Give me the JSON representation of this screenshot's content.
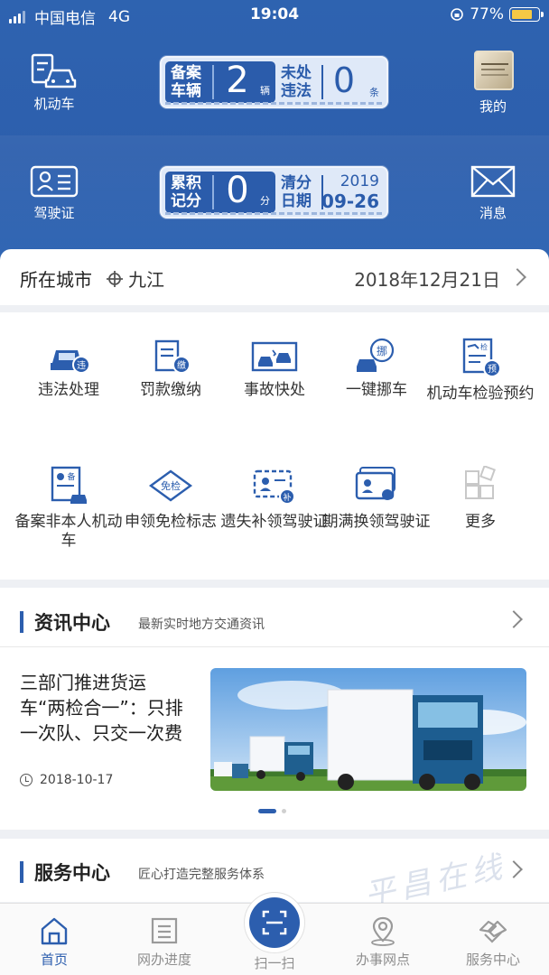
{
  "status_bar": {
    "carrier": "中国电信",
    "network": "4G",
    "time": "19:04",
    "battery": "77%",
    "battery_level": 0.77
  },
  "header": {
    "vehicle_label": "机动车",
    "license_label": "驾驶证",
    "me_label": "我的",
    "message_label": "消息",
    "panel1": {
      "left_label": "备案车辆",
      "left_value": "2",
      "left_unit": "辆",
      "right_label": "未处违法",
      "right_value": "0",
      "right_unit": "条"
    },
    "panel2": {
      "left_label": "累积记分",
      "left_value": "0",
      "left_unit": "分",
      "right_label": "清分日期",
      "year": "2019",
      "month_day": "09-26"
    }
  },
  "city_bar": {
    "label": "所在城市",
    "city": "九江",
    "date": "2018年12月21日"
  },
  "services": [
    {
      "label": "违法处理",
      "icon": "car-violation-icon"
    },
    {
      "label": "罚款缴纳",
      "icon": "fine-payment-icon"
    },
    {
      "label": "事故快处",
      "icon": "accident-icon"
    },
    {
      "label": "一键挪车",
      "icon": "move-car-icon"
    },
    {
      "label": "机动车检验预约",
      "icon": "inspection-booking-icon"
    },
    {
      "label": "备案非本人机动车",
      "icon": "register-vehicle-icon"
    },
    {
      "label": "申领免检标志",
      "icon": "exempt-badge-icon"
    },
    {
      "label": "遗失补领驾驶证",
      "icon": "reissue-license-icon"
    },
    {
      "label": "期满换领驾驶证",
      "icon": "renew-license-icon"
    },
    {
      "label": "更多",
      "icon": "more-grid-icon"
    }
  ],
  "icon_badges": {
    "violation": "违",
    "fine": "缴",
    "move": "挪",
    "inspection_top": "检",
    "inspection": "预",
    "register": "备",
    "exempt": "免检",
    "reissue": "补"
  },
  "news": {
    "section_title": "资讯中心",
    "section_subtitle": "最新实时地方交通资讯",
    "title": "三部门推进货运车“两检合一”：只排一次队、只交一次费",
    "date": "2018-10-17"
  },
  "service_center": {
    "title": "服务中心",
    "subtitle": "匠心打造完整服务体系"
  },
  "tabs": [
    {
      "label": "首页",
      "icon": "home-icon",
      "active": true
    },
    {
      "label": "网办进度",
      "icon": "progress-icon",
      "active": false
    },
    {
      "label": "扫一扫",
      "icon": "scan-icon",
      "active": false
    },
    {
      "label": "办事网点",
      "icon": "location-icon",
      "active": false
    },
    {
      "label": "服务中心",
      "icon": "handshake-icon",
      "active": false
    }
  ],
  "watermark": "平昌在线",
  "colors": {
    "primary": "#2c5eae",
    "header": "#2e63b0",
    "battery": "#f6c945"
  }
}
